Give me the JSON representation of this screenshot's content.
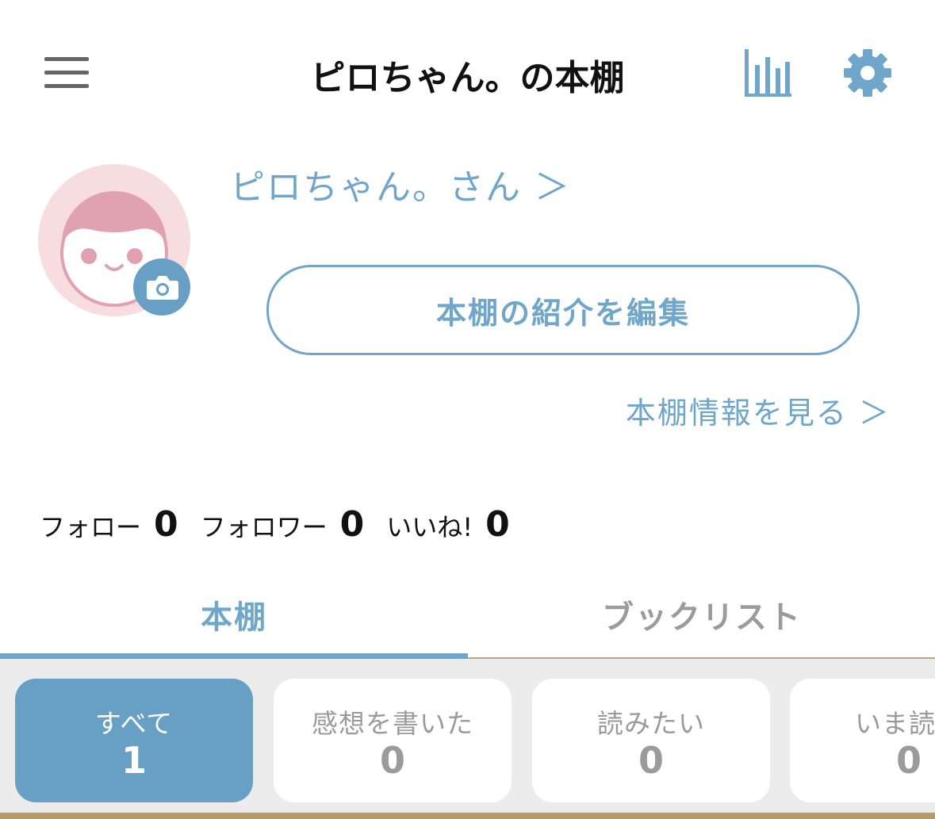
{
  "header": {
    "title": "ピロちゃん。の本棚",
    "menu_icon": "hamburger-menu-icon",
    "stats_icon": "bar-chart-icon",
    "settings_icon": "gear-icon"
  },
  "profile": {
    "user_link": "ピロちゃん。さん ＞",
    "edit_button": "本棚の紹介を編集",
    "info_link": "本棚情報を見る ＞",
    "avatar_icon": "avatar-face-icon",
    "camera_icon": "camera-icon"
  },
  "counts": [
    {
      "label": "フォロー",
      "value": "0"
    },
    {
      "label": "フォロワー",
      "value": "0"
    },
    {
      "label": "いいね!",
      "value": "0"
    }
  ],
  "tabs": [
    {
      "label": "本棚",
      "active": true
    },
    {
      "label": "ブックリスト",
      "active": false
    }
  ],
  "filters": [
    {
      "label": "すべて",
      "count": "1",
      "active": true
    },
    {
      "label": "感想を書いた",
      "count": "0",
      "active": false
    },
    {
      "label": "読みたい",
      "count": "0",
      "active": false
    },
    {
      "label": "いま読ん",
      "count": "0",
      "active": false
    }
  ],
  "colors": {
    "accent": "#6fa6c9",
    "active_card": "#679fc5",
    "avatar_bg": "#f7dde0",
    "avatar_face": "#e0a2b0",
    "bottom_bar": "#b99a68"
  }
}
